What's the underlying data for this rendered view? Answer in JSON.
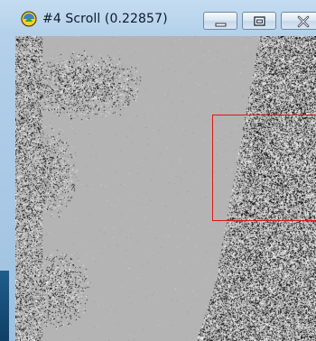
{
  "window": {
    "title": "#4 Scroll (0.22857)",
    "icon": "imagej-icon"
  },
  "titlebar_buttons": {
    "minimize_icon": "minimize-icon",
    "maximize_icon": "maximize-icon",
    "close_icon": "close-icon"
  },
  "canvas": {
    "background_color": "#b4b4b4",
    "roi_color": "#e01414"
  }
}
